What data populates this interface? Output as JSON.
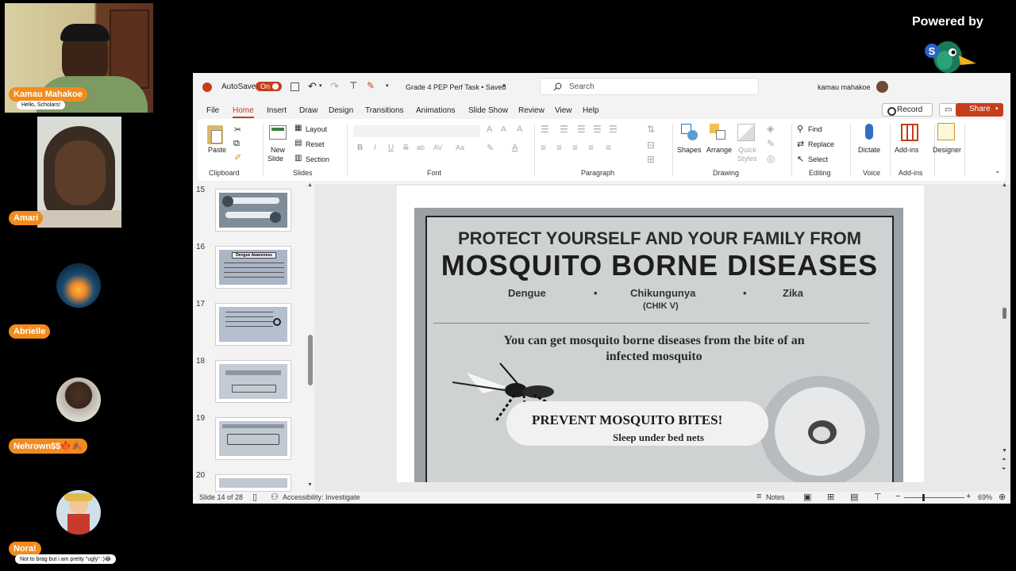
{
  "participants": [
    {
      "name": "Kamau Mahakoe",
      "message": "Hello, Scholars!"
    },
    {
      "name": "Amari"
    },
    {
      "name": "Abrielle"
    },
    {
      "name": "Nehrown$$🍁🍂"
    },
    {
      "name": "Nora!",
      "message": "Not to brag but i am pretty \"ugly\" :)😂"
    }
  ],
  "branding": {
    "powered_by": "Powered by",
    "logo_text": "StreamYard"
  },
  "titlebar": {
    "autosave_label": "AutoSave",
    "autosave_state": "On",
    "doc_title": "Grade 4 PEP Perf Task • Saved",
    "search_placeholder": "Search",
    "user": "kamau mahakoe"
  },
  "menu": {
    "tabs": [
      "File",
      "Home",
      "Insert",
      "Draw",
      "Design",
      "Transitions",
      "Animations",
      "Slide Show",
      "Review",
      "View",
      "Help"
    ],
    "active": "Home",
    "record_label": "Record",
    "share_label": "Share"
  },
  "ribbon": {
    "paste": "Paste",
    "new_slide": "New",
    "new_slide2": "Slide",
    "layout": "Layout",
    "reset": "Reset",
    "section": "Section",
    "shapes": "Shapes",
    "arrange": "Arrange",
    "quick_styles": "Quick",
    "quick_styles2": "Styles",
    "find": "Find",
    "replace": "Replace",
    "select": "Select",
    "dictate": "Dictate",
    "addins": "Add-ins",
    "designer": "Designer",
    "groups": [
      "Clipboard",
      "Slides",
      "Font",
      "Paragraph",
      "Drawing",
      "Editing",
      "Voice",
      "Add-ins"
    ],
    "font_btns": [
      "B",
      "I",
      "U",
      "S",
      "ab",
      "AV",
      "Aa",
      "A"
    ]
  },
  "thumbnails": [
    {
      "num": "15"
    },
    {
      "num": "16",
      "caption": "Dengue Awareness"
    },
    {
      "num": "17"
    },
    {
      "num": "18"
    },
    {
      "num": "19"
    },
    {
      "num": "20"
    }
  ],
  "slide": {
    "line1": "PROTECT YOURSELF AND YOUR FAMILY FROM",
    "line2": "MOSQUITO BORNE DISEASES",
    "disease1": "Dengue",
    "disease2": "Chikungunya",
    "disease2_sub": "(CHIK V)",
    "disease3": "Zika",
    "bullet": "•",
    "bite_text": "You can get mosquito borne diseases from the bite of an infected mosquito",
    "prevent": "PREVENT MOSQUITO BITES!",
    "sleep": "Sleep under bed nets"
  },
  "status": {
    "slide_info": "Slide 14 of 28",
    "accessibility": "Accessibility: Investigate",
    "notes": "Notes",
    "zoom": "69%"
  }
}
